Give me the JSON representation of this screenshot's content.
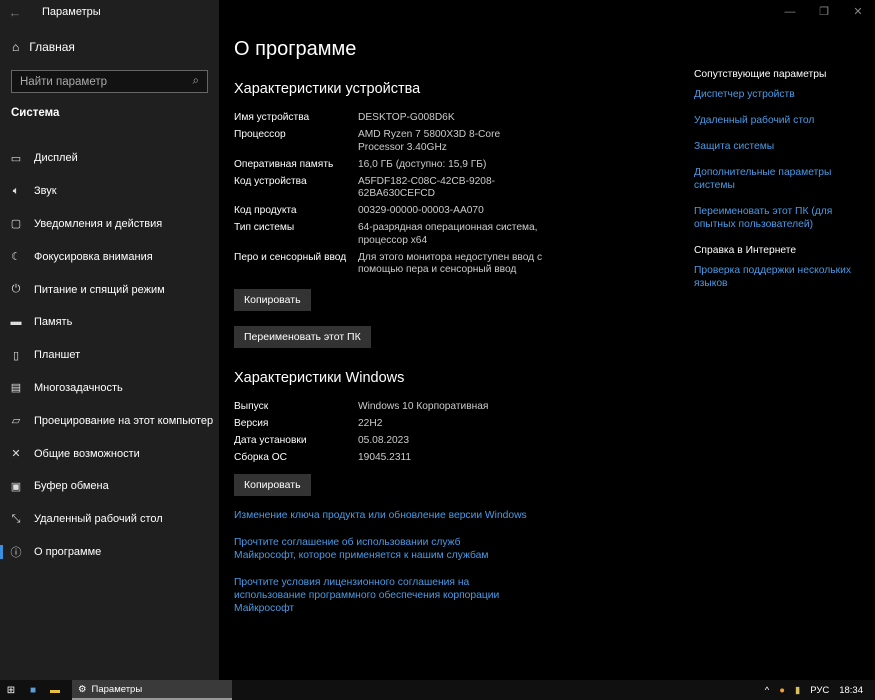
{
  "window": {
    "title": "Параметры"
  },
  "sidebar": {
    "home": "Главная",
    "search_placeholder": "Найти параметр",
    "section": "Система",
    "items": [
      {
        "label": "Дисплей",
        "icon": "display-icon"
      },
      {
        "label": "Звук",
        "icon": "sound-icon"
      },
      {
        "label": "Уведомления и действия",
        "icon": "notifications-icon"
      },
      {
        "label": "Фокусировка внимания",
        "icon": "focus-icon"
      },
      {
        "label": "Питание и спящий режим",
        "icon": "power-icon"
      },
      {
        "label": "Память",
        "icon": "storage-icon"
      },
      {
        "label": "Планшет",
        "icon": "tablet-icon"
      },
      {
        "label": "Многозадачность",
        "icon": "multitasking-icon"
      },
      {
        "label": "Проецирование на этот компьютер",
        "icon": "projecting-icon"
      },
      {
        "label": "Общие возможности",
        "icon": "shared-icon"
      },
      {
        "label": "Буфер обмена",
        "icon": "clipboard-icon"
      },
      {
        "label": "Удаленный рабочий стол",
        "icon": "remote-desktop-icon"
      },
      {
        "label": "О программе",
        "icon": "info-icon",
        "active": true
      }
    ]
  },
  "main": {
    "title": "О программе",
    "device_heading": "Характеристики устройства",
    "device": [
      {
        "k": "Имя устройства",
        "v": "DESKTOP-G008D6K"
      },
      {
        "k": "Процессор",
        "v": "AMD Ryzen 7 5800X3D 8-Core Processor 3.40GHz"
      },
      {
        "k": "Оперативная память",
        "v": "16,0 ГБ (доступно: 15,9 ГБ)"
      },
      {
        "k": "Код устройства",
        "v": "A5FDF182-C08C-42CB-9208-62BA630CEFCD"
      },
      {
        "k": "Код продукта",
        "v": "00329-00000-00003-AA070"
      },
      {
        "k": "Тип системы",
        "v": "64-разрядная операционная система, процессор x64"
      },
      {
        "k": "Перо и сенсорный ввод",
        "v": "Для этого монитора недоступен ввод с помощью пера и сенсорный ввод"
      }
    ],
    "copy": "Копировать",
    "rename": "Переименовать этот ПК",
    "windows_heading": "Характеристики Windows",
    "windows": [
      {
        "k": "Выпуск",
        "v": "Windows 10 Корпоративная"
      },
      {
        "k": "Версия",
        "v": "22H2"
      },
      {
        "k": "Дата установки",
        "v": "05.08.2023"
      },
      {
        "k": "Сборка ОС",
        "v": "19045.2311"
      }
    ],
    "links": [
      "Изменение ключа продукта или обновление версии Windows",
      "Прочтите соглашение об использовании служб Майкрософт, которое применяется к нашим службам",
      "Прочтите условия лицензионного соглашения на использование программного обеспечения корпорации Майкрософт"
    ]
  },
  "related": {
    "heading": "Сопутствующие параметры",
    "links": [
      "Диспетчер устройств",
      "Удаленный рабочий стол",
      "Защита системы",
      "Дополнительные параметры системы",
      "Переименовать этот ПК (для опытных пользователей)"
    ],
    "help_heading": "Справка в Интернете",
    "help_links": [
      "Проверка поддержки нескольких языков"
    ]
  },
  "taskbar": {
    "app": "Параметры",
    "lang": "РУС",
    "time": "18:34"
  }
}
